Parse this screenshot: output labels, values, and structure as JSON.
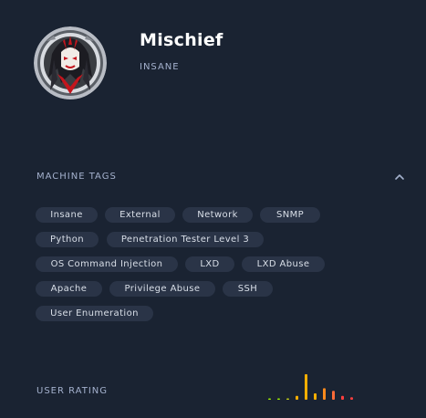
{
  "machine": {
    "name": "Mischief",
    "difficulty": "INSANE"
  },
  "icons": {
    "avatar": "avatar-icon",
    "collapse": "chevron-up-icon"
  },
  "tags": {
    "title": "MACHINE TAGS",
    "items": [
      "Insane",
      "External",
      "Network",
      "SNMP",
      "Python",
      "Penetration Tester Level 3",
      "OS Command Injection",
      "LXD",
      "LXD Abuse",
      "Apache",
      "Privilege Abuse",
      "SSH",
      "User Enumeration"
    ]
  },
  "rating": {
    "title": "USER RATING",
    "levels": [
      0.05,
      0.05,
      0.05,
      0.15,
      1.0,
      0.25,
      0.45,
      0.35,
      0.15,
      0.1
    ],
    "colors": [
      "#9fef00",
      "#9fef00",
      "#c5d017",
      "#ffaf00",
      "#ffaf00",
      "#ffaf00",
      "#ff8a1c",
      "#ff6b38",
      "#ff3e3e",
      "#ff3e3e"
    ]
  },
  "colors": {
    "background": "#1a2332",
    "tag_background": "#2a3447",
    "muted_text": "#a4b1cd",
    "accent": "#9fef00"
  }
}
